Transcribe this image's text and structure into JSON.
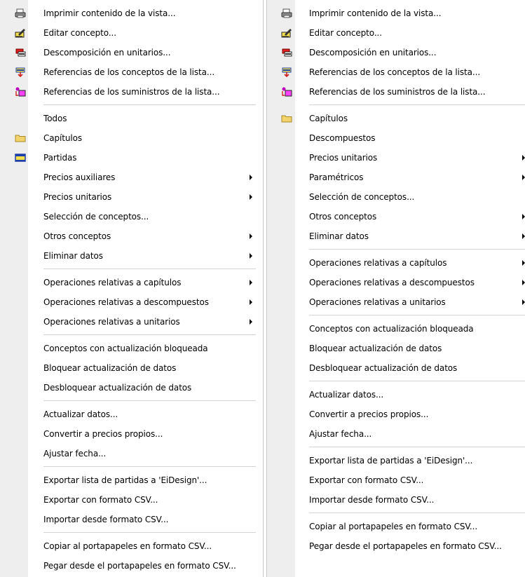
{
  "left_menu": {
    "print": "Imprimir contenido de la vista...",
    "edit": "Editar concepto...",
    "decomp": "Descomposición en unitarios...",
    "ref_concepts": "Referencias de los conceptos de la lista...",
    "ref_supplies": "Referencias de los suministros de la lista...",
    "todos": "Todos",
    "capitulos": "Capítulos",
    "partidas": "Partidas",
    "precios_aux": "Precios auxiliares",
    "precios_unit": "Precios unitarios",
    "seleccion": "Selección de conceptos...",
    "otros": "Otros conceptos",
    "eliminar": "Eliminar datos",
    "ops_cap": "Operaciones relativas a capítulos",
    "ops_desc": "Operaciones relativas a descompuestos",
    "ops_unit": "Operaciones relativas a unitarios",
    "conc_bloq": "Conceptos con actualización bloqueada",
    "bloquear": "Bloquear actualización de datos",
    "desbloquear": "Desbloquear actualización de datos",
    "actualizar": "Actualizar datos...",
    "convertir": "Convertir a precios propios...",
    "ajustar": "Ajustar fecha...",
    "exp_eidesign": "Exportar lista de partidas a 'EiDesign'...",
    "exp_csv": "Exportar con formato CSV...",
    "imp_csv": "Importar desde formato CSV...",
    "copiar_csv": "Copiar al portapapeles en formato CSV...",
    "pegar_csv": "Pegar desde el portapapeles en formato CSV..."
  },
  "right_menu": {
    "print": "Imprimir contenido de la vista...",
    "edit": "Editar concepto...",
    "decomp": "Descomposición en unitarios...",
    "ref_concepts": "Referencias de los conceptos de la lista...",
    "ref_supplies": "Referencias de los suministros de la lista...",
    "capitulos": "Capítulos",
    "descompuestos": "Descompuestos",
    "precios_unit": "Precios unitarios",
    "parametricos": "Paramétricos",
    "seleccion": "Selección de conceptos...",
    "otros": "Otros conceptos",
    "eliminar": "Eliminar datos",
    "ops_cap": "Operaciones relativas a capítulos",
    "ops_desc": "Operaciones relativas a descompuestos",
    "ops_unit": "Operaciones relativas a unitarios",
    "conc_bloq": "Conceptos con actualización bloqueada",
    "bloquear": "Bloquear actualización de datos",
    "desbloquear": "Desbloquear actualización de datos",
    "actualizar": "Actualizar datos...",
    "convertir": "Convertir a precios propios...",
    "ajustar": "Ajustar fecha...",
    "exp_eidesign": "Exportar lista de partidas a 'EiDesign'...",
    "exp_csv": "Exportar con formato CSV...",
    "imp_csv": "Importar desde formato CSV...",
    "copiar_csv": "Copiar al portapapeles en formato CSV...",
    "pegar_csv": "Pegar desde el portapapeles en formato CSV..."
  },
  "icons": {
    "print": "printer-icon",
    "edit": "edit-concept-icon",
    "decomp": "decomposition-icon",
    "ref_concepts": "concept-references-icon",
    "ref_supplies": "supply-references-icon",
    "capitulos": "folder-icon",
    "partidas": "partidas-icon"
  },
  "colors": {
    "gutter": "#eeeeee",
    "separator": "#d4d4d4",
    "folder": "#f2d36b",
    "partidas_fill": "#f4e04d",
    "partidas_border": "#1e3fa8"
  }
}
